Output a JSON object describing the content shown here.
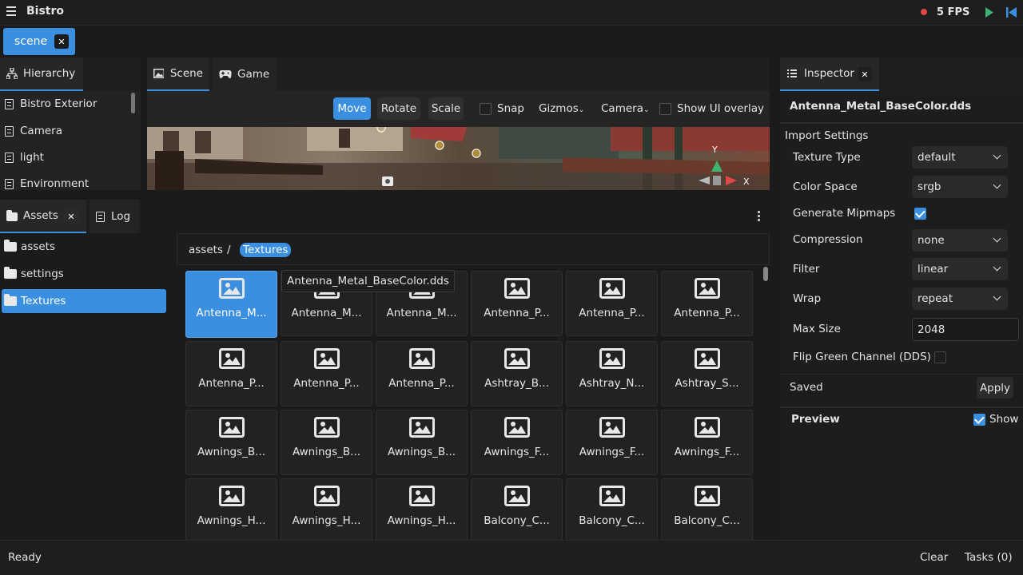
{
  "app": {
    "title": "Bistro",
    "fps": "5 FPS"
  },
  "document_tab": {
    "label": "scene"
  },
  "hierarchy": {
    "tab_label": "Hierarchy",
    "items": [
      {
        "label": "Bistro Exterior"
      },
      {
        "label": "Camera"
      },
      {
        "label": "light"
      },
      {
        "label": "Environment"
      }
    ]
  },
  "scene_panel": {
    "tabs": [
      {
        "label": "Scene"
      },
      {
        "label": "Game"
      }
    ],
    "toolbar": {
      "move": "Move",
      "rotate": "Rotate",
      "scale": "Scale",
      "snap": "Snap",
      "gizmos": "Gizmos",
      "camera": "Camera",
      "show_ui_overlay": "Show UI overlay"
    },
    "axis_y": "Y",
    "axis_x": "X"
  },
  "assets_panel": {
    "tabs": [
      {
        "label": "Assets"
      },
      {
        "label": "Log"
      }
    ],
    "folders": [
      {
        "label": "assets"
      },
      {
        "label": "settings"
      },
      {
        "label": "Textures",
        "selected": true
      }
    ],
    "breadcrumb": {
      "root": "assets",
      "separator": "/",
      "current": "Textures"
    },
    "tooltip": "Antenna_Metal_BaseColor.dds",
    "tiles": [
      "Antenna_M...",
      "Antenna_M...",
      "Antenna_M...",
      "Antenna_P...",
      "Antenna_P...",
      "Antenna_P...",
      "Antenna_P...",
      "Antenna_P...",
      "Antenna_P...",
      "Ashtray_B...",
      "Ashtray_N...",
      "Ashtray_S...",
      "Awnings_B...",
      "Awnings_B...",
      "Awnings_B...",
      "Awnings_F...",
      "Awnings_F...",
      "Awnings_F...",
      "Awnings_H...",
      "Awnings_H...",
      "Awnings_H...",
      "Balcony_C...",
      "Balcony_C...",
      "Balcony_C..."
    ]
  },
  "inspector": {
    "tab_label": "Inspector",
    "file_name": "Antenna_Metal_BaseColor.dds",
    "section_title": "Import Settings",
    "fields": {
      "texture_type": {
        "label": "Texture Type",
        "value": "default"
      },
      "color_space": {
        "label": "Color Space",
        "value": "srgb"
      },
      "generate_mipmaps": {
        "label": "Generate Mipmaps",
        "checked": true
      },
      "compression": {
        "label": "Compression",
        "value": "none"
      },
      "filter": {
        "label": "Filter",
        "value": "linear"
      },
      "wrap": {
        "label": "Wrap",
        "value": "repeat"
      },
      "max_size": {
        "label": "Max Size",
        "value": "2048"
      },
      "flip_green": {
        "label": "Flip Green Channel (DDS)",
        "checked": false
      }
    },
    "saved_label": "Saved",
    "apply_label": "Apply",
    "preview_label": "Preview",
    "show_label": "Show"
  },
  "status_bar": {
    "status": "Ready",
    "clear": "Clear",
    "tasks": "Tasks (0)"
  },
  "colors": {
    "accent": "#3b8fe0",
    "background": "#1b1b1b",
    "record": "#e04848",
    "play": "#3cb371"
  }
}
